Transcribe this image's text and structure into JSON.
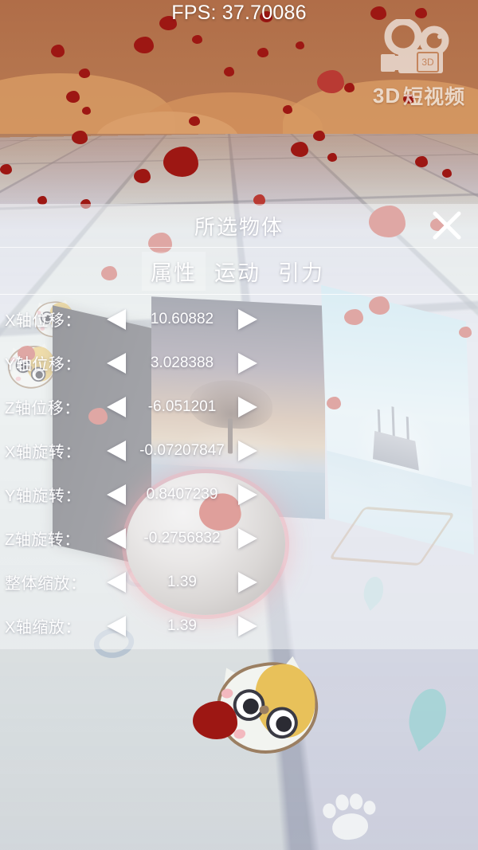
{
  "hud": {
    "fps_label": "FPS: 37.70086",
    "watermark": {
      "icon": "movie-camera-icon",
      "brand_3d": "3D",
      "brand_text": "短视频"
    }
  },
  "panel": {
    "title": "所选物体",
    "close_icon": "close-icon",
    "tabs": [
      {
        "label": "属性",
        "active": true
      },
      {
        "label": "运动",
        "active": false
      },
      {
        "label": "引力",
        "active": false
      }
    ],
    "decrement_icon": "triangle-left-icon",
    "increment_icon": "triangle-right-icon",
    "rows": [
      {
        "label": "X轴位移：",
        "value": "10.60882"
      },
      {
        "label": "Y轴位移：",
        "value": "3.028388"
      },
      {
        "label": "Z轴位移：",
        "value": "-6.051201"
      },
      {
        "label": "X轴旋转：",
        "value": "-0.07207847"
      },
      {
        "label": "Y轴旋转：",
        "value": "0.8407239"
      },
      {
        "label": "Z轴旋转：",
        "value": "-0.2756832"
      },
      {
        "label": "整体缩放：",
        "value": "1.39"
      },
      {
        "label": "X轴缩放：",
        "value": "1.39"
      }
    ]
  },
  "scene": {
    "sky_color": "#b0714d",
    "hill_color": "#d79a63",
    "floor_tile_color": "#e3e8ec",
    "petal_color": "#9d1713",
    "selection_highlight_color": "#ed7480",
    "objects": [
      {
        "name": "dark-panel"
      },
      {
        "name": "tree-painting-panel"
      },
      {
        "name": "ship-painting-panel"
      },
      {
        "name": "selected-sphere"
      }
    ]
  }
}
